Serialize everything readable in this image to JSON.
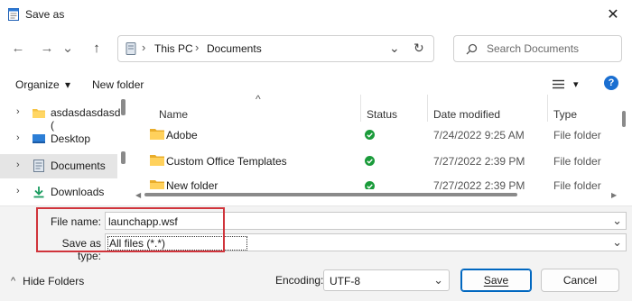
{
  "window": {
    "title": "Save as",
    "close_glyph": "✕"
  },
  "nav": {
    "back_glyph": "←",
    "forward_glyph": "→",
    "recent_glyph": "⌄",
    "up_glyph": "↑",
    "breadcrumb": [
      "This PC",
      "Documents"
    ],
    "breadcrumb_sep": "›",
    "address_dropdown_glyph": "⌄",
    "refresh_glyph": "↻",
    "search_placeholder": "Search Documents"
  },
  "commandbar": {
    "organize_label": "Organize",
    "organize_caret": "▾",
    "new_folder_label": "New folder",
    "view_caret": "▾",
    "help_glyph": "?"
  },
  "sidebar": {
    "items": [
      {
        "label": "asdasdasdasd (",
        "icon": "folder-icon"
      },
      {
        "label": "Desktop",
        "icon": "desktop-icon"
      },
      {
        "label": "Documents",
        "icon": "documents-icon",
        "selected": true
      },
      {
        "label": "Downloads",
        "icon": "downloads-icon"
      }
    ]
  },
  "filelist": {
    "sort_glyph": "^",
    "columns": [
      "Name",
      "Status",
      "Date modified",
      "Type"
    ],
    "rows": [
      {
        "name": "Adobe",
        "status": "synced",
        "date": "7/24/2022 9:25 AM",
        "type": "File folder"
      },
      {
        "name": "Custom Office Templates",
        "status": "synced",
        "date": "7/27/2022 2:39 PM",
        "type": "File folder"
      },
      {
        "name": "New folder",
        "status": "synced",
        "date": "7/27/2022 2:39 PM",
        "type": "File folder"
      }
    ]
  },
  "form": {
    "filename_label": "File name:",
    "filename_value": "launchapp.wsf",
    "savetype_label": "Save as type:",
    "savetype_value": "All files  (*.*)",
    "dropdown_glyph": "⌄",
    "encoding_label": "Encoding:",
    "encoding_value": "UTF-8",
    "hide_folders_label": "Hide Folders",
    "hide_folders_glyph": "^",
    "save_label": "Save",
    "cancel_label": "Cancel"
  },
  "colors": {
    "accent": "#0067c0",
    "highlight": "#d0343b",
    "status_ok": "#1a9b3a",
    "folder": "#f6c343"
  }
}
